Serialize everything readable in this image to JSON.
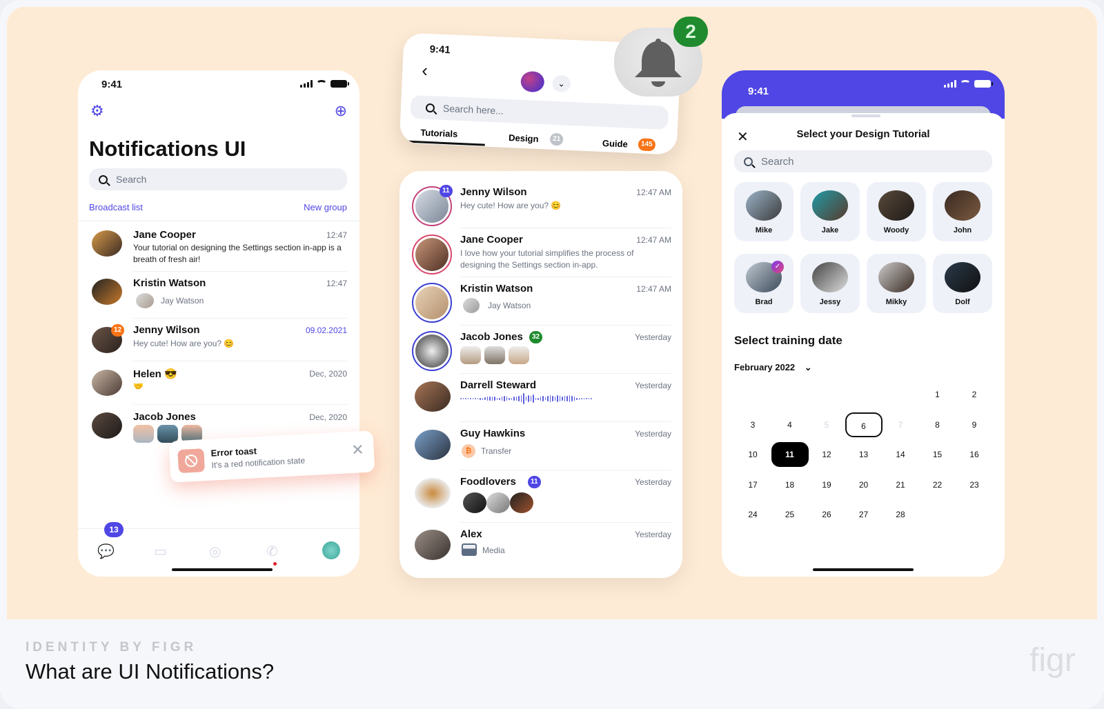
{
  "footer": {
    "kicker": "IDENTITY BY FIGR",
    "title": "What are UI Notifications?",
    "logo": "figr"
  },
  "colors": {
    "accent": "#4f46e5",
    "hero_bg": "#feebd5",
    "badge_orange": "#f97316",
    "badge_green": "#1f8b2e",
    "toast_red": "#f0a89a"
  },
  "left_phone": {
    "status_time": "9:41",
    "settings_icon": "gear-icon",
    "new_chat_icon": "chat-plus-icon",
    "title": "Notifications UI",
    "search_placeholder": "Search",
    "broadcast_link": "Broadcast list",
    "new_group_link": "New group",
    "chats": [
      {
        "name": "Jane Cooper",
        "time": "12:47",
        "message": "Your tutorial on designing the Settings section in-app is a breath of fresh air!"
      },
      {
        "name": "Kristin Watson",
        "time": "12:47",
        "message": "Jay Watson"
      },
      {
        "name": "Jenny Wilson",
        "time": "09.02.2021",
        "message": "Hey cute! How are you? 😊",
        "badge": "12"
      },
      {
        "name": "Helen 😎",
        "time": "Dec, 2020",
        "message": "🤝"
      },
      {
        "name": "Jacob Jones",
        "time": "Dec, 2020",
        "message": ""
      }
    ],
    "toast": {
      "title": "Error toast",
      "subtitle": "It's a red notification state",
      "close": "✕"
    },
    "tabbar": {
      "chats_badge": "13",
      "icons": [
        "chat-icon",
        "video-icon",
        "camera-icon",
        "phone-icon",
        "profile-avatar"
      ]
    }
  },
  "middle": {
    "status_time": "9:41",
    "back": "‹",
    "search_placeholder": "Search here...",
    "tabs": [
      {
        "label": "Tutorials",
        "count": ""
      },
      {
        "label": "Design",
        "count": "21"
      },
      {
        "label": "Guide",
        "count": "145"
      }
    ],
    "bell_badge": "2",
    "chats": [
      {
        "name": "Jenny Wilson",
        "time": "12:47 AM",
        "message": "Hey cute! How are you? 😊",
        "badge": "11"
      },
      {
        "name": "Jane Cooper",
        "time": "12:47 AM",
        "message": "I love how your tutorial simplifies the process of designing the Settings section in-app."
      },
      {
        "name": "Kristin Watson",
        "time": "12:47 AM",
        "message": "Jay Watson"
      },
      {
        "name": "Jacob Jones",
        "time": "Yesterday",
        "message": "",
        "badge": "32"
      },
      {
        "name": "Darrell Steward",
        "time": "Yesterday",
        "message": ""
      },
      {
        "name": "Guy Hawkins",
        "time": "Yesterday",
        "message": "Transfer"
      },
      {
        "name": "Foodlovers",
        "time": "Yesterday",
        "message": "",
        "badge": "11"
      },
      {
        "name": "Alex",
        "time": "Yesterday",
        "message": "Media"
      }
    ]
  },
  "right_phone": {
    "status_time": "9:41",
    "sheet_title": "Select your Design Tutorial",
    "close": "✕",
    "search_placeholder": "Search",
    "trainers": [
      "Mike",
      "Jake",
      "Woody",
      "John",
      "Brad",
      "Jessy",
      "Mikky",
      "Dolf"
    ],
    "selected_trainer": "Brad",
    "date_heading": "Select training date",
    "month": "February 2022",
    "days": [
      "1",
      "2",
      "3",
      "4",
      "5",
      "6",
      "7",
      "8",
      "9",
      "10",
      "11",
      "12",
      "13",
      "14",
      "15",
      "16",
      "17",
      "18",
      "19",
      "20",
      "21",
      "22",
      "23",
      "24",
      "25",
      "26",
      "27",
      "28"
    ],
    "outlined_day": "6",
    "selected_day": "11",
    "muted_days": [
      "5",
      "7"
    ]
  }
}
